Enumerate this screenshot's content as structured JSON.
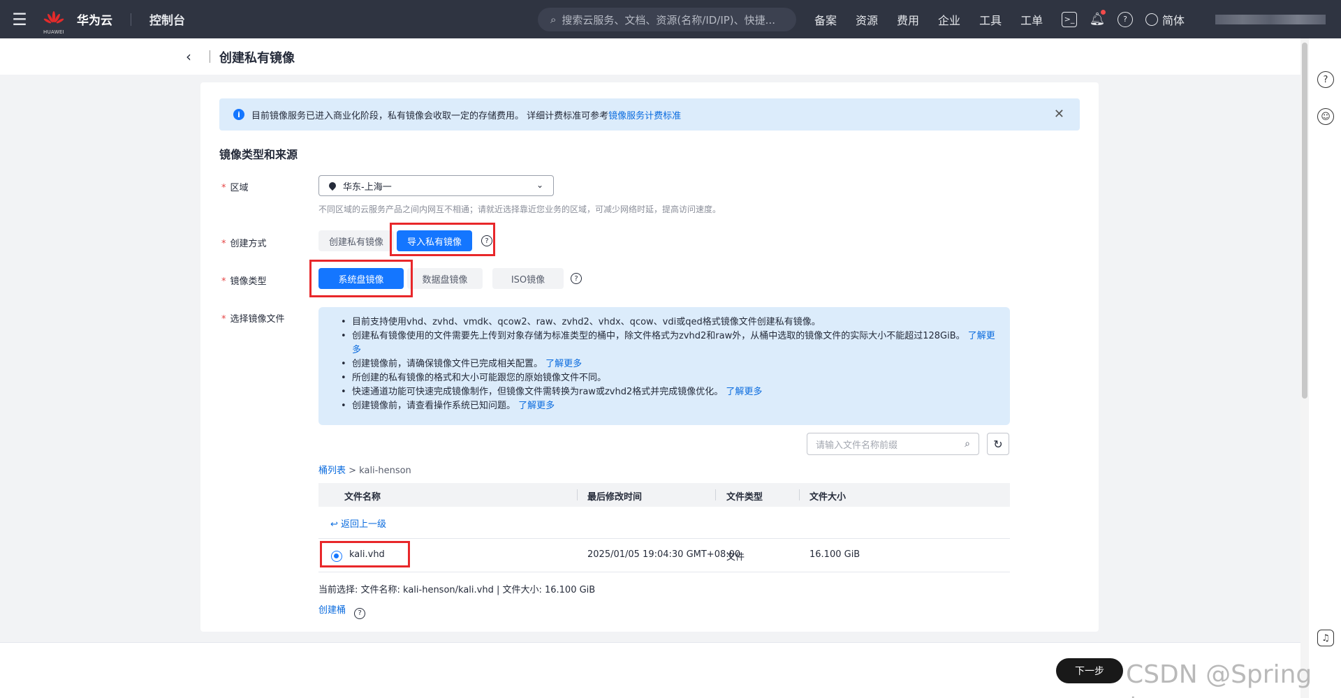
{
  "topnav": {
    "brand": "华为云",
    "brand_sub": "HUAWEI",
    "console": "控制台",
    "search_placeholder": "搜索云服务、文档、资源(名称/ID/IP)、快捷...",
    "links": [
      "备案",
      "资源",
      "费用",
      "企业",
      "工具",
      "工单"
    ],
    "lang": "简体"
  },
  "header": {
    "title": "创建私有镜像"
  },
  "notice": {
    "text": "目前镜像服务已进入商业化阶段，私有镜像会收取一定的存储费用。 详细计费标准可参考",
    "link": "镜像服务计费标准"
  },
  "section_title": "镜像类型和来源",
  "form": {
    "region_label": "区域",
    "region_value": "华东-上海一",
    "region_hint": "不同区域的云服务产品之间内网互不相通；请就近选择靠近您业务的区域，可减少网络时延，提高访问速度。",
    "method_label": "创建方式",
    "method_options": [
      "创建私有镜像",
      "导入私有镜像"
    ],
    "type_label": "镜像类型",
    "type_options": [
      "系统盘镜像",
      "数据盘镜像",
      "ISO镜像"
    ],
    "file_label": "选择镜像文件"
  },
  "info_items": [
    {
      "text": "目前支持使用vhd、zvhd、vmdk、qcow2、raw、zvhd2、vhdx、qcow、vdi或qed格式镜像文件创建私有镜像。",
      "link": ""
    },
    {
      "text": "创建私有镜像使用的文件需要先上传到对象存储为标准类型的桶中，除文件格式为zvhd2和raw外，从桶中选取的镜像文件的实际大小不能超过128GiB。",
      "link": "了解更多"
    },
    {
      "text": "创建镜像前，请确保镜像文件已完成相关配置。",
      "link": "了解更多"
    },
    {
      "text": "所创建的私有镜像的格式和大小可能跟您的原始镜像文件不同。",
      "link": ""
    },
    {
      "text": "快速通道功能可快速完成镜像制作，但镜像文件需转换为raw或zvhd2格式并完成镜像优化。",
      "link": "了解更多"
    },
    {
      "text": "创建镜像前，请查看操作系统已知问题。",
      "link": "了解更多"
    }
  ],
  "file_search_placeholder": "请输入文件名称前缀",
  "crumb": {
    "link": "桶列表",
    "current": " > kali-henson"
  },
  "table": {
    "headers": [
      "文件名称",
      "最后修改时间",
      "文件类型",
      "文件大小"
    ],
    "back_link": "返回上一级",
    "rows": [
      {
        "name": "kali.vhd",
        "modified": "2025/01/05 19:04:30 GMT+08:00",
        "type": "文件",
        "size": "16.100 GiB"
      }
    ]
  },
  "current_selection": "当前选择: 文件名称:  kali-henson/kali.vhd | 文件大小: 16.100 GiB",
  "create_bucket": "创建桶",
  "footer": {
    "next": "下一步"
  },
  "watermark": "CSDN @Spring  胡"
}
